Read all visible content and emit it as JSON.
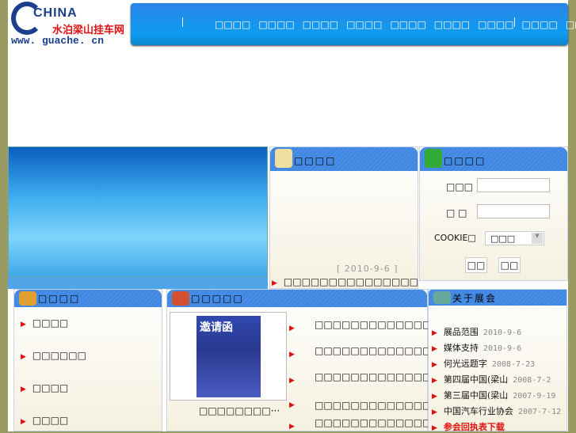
{
  "logo": {
    "brand": "CHINA",
    "name": "水泊梁山挂车网",
    "url": "www. guache. cn"
  },
  "nav": {
    "items": [
      "□□□□",
      "□□□□",
      "□□□□",
      "□□□□",
      "□□□□",
      "□□□□",
      "□□□□",
      "□□□□",
      "□□□□"
    ]
  },
  "news": {
    "title": "□□□□",
    "date": "[ 2010-9-6 ]",
    "ticker": "□□□□□□□□□□□□□□□□□□□□□□□□□□□□□"
  },
  "login": {
    "title": "□□□□",
    "user_label": "□□□",
    "pass_label": "□ □",
    "cookie_label": "COOKIE□",
    "cookie_value": "□□□",
    "login_btn": "□□",
    "reset_btn": "□□"
  },
  "left": {
    "title": "□□□□",
    "items": [
      "□□□□",
      "□□□□□□",
      "□□□□",
      "□□□□"
    ]
  },
  "mid": {
    "title": "□□□□□",
    "image_text": "邀请函",
    "caption": "□□□□□□□□···",
    "items": [
      "□□□□□□□□□□□□□□□□□□□□□□",
      "□□□□□□□□□□□□□□□□□□□□□···",
      "□□□□□□□□□□□□□□□□□□□□",
      "□□□□□□□□□□□□□□□□",
      "□□□□□□□□□□□□□□□□□□□□□"
    ]
  },
  "right": {
    "title": "关于展会",
    "items": [
      {
        "t": "展品范围",
        "d": "2010-9-6"
      },
      {
        "t": "媒体支持",
        "d": "2010-9-6"
      },
      {
        "t": "何光远题字",
        "d": "2008-7-23"
      },
      {
        "t": "第四届中国(梁山",
        "d": "2008-7-2"
      },
      {
        "t": "第三届中国(梁山",
        "d": "2007-9-19"
      },
      {
        "t": "中国汽车行业协会",
        "d": "2007-7-12"
      }
    ],
    "download": "参会回执表下载"
  }
}
